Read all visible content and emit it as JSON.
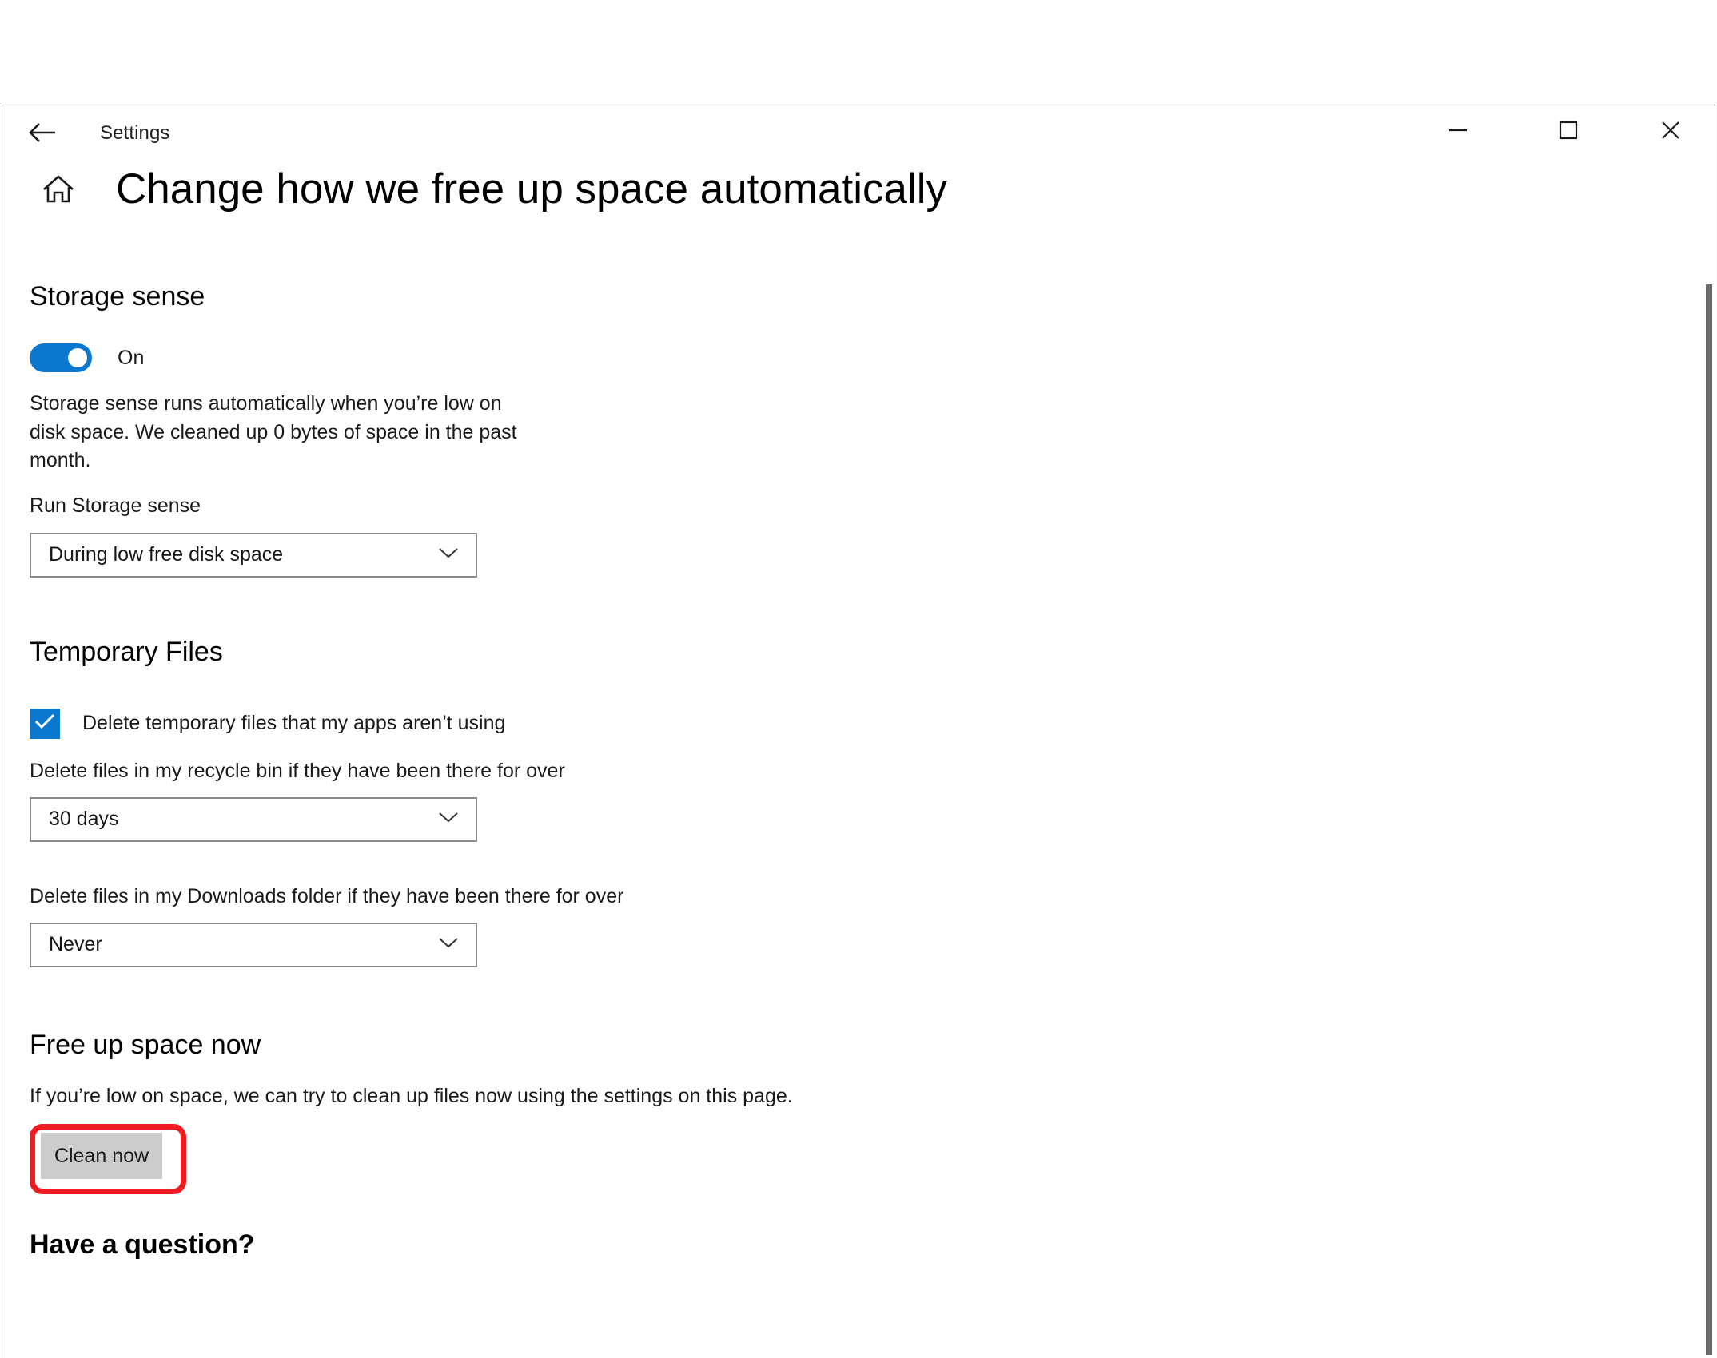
{
  "window": {
    "app_title": "Settings",
    "back_icon": "back-arrow-icon",
    "minimize_icon": "minimize-icon",
    "maximize_icon": "maximize-icon",
    "close_icon": "close-icon"
  },
  "header": {
    "home_icon": "home-icon",
    "page_title": "Change how we free up space automatically"
  },
  "storage_sense": {
    "heading": "Storage sense",
    "toggle_state": "On",
    "toggle_label": "On",
    "description": "Storage sense runs automatically when you’re low on disk space. We cleaned up 0 bytes of space in the past month.",
    "run_label": "Run Storage sense",
    "run_value": "During low free disk space",
    "chevron_icon": "chevron-down-icon"
  },
  "temporary_files": {
    "heading": "Temporary Files",
    "checkbox_checked": true,
    "checkbox_label": "Delete temporary files that my apps aren’t using",
    "recycle_bin_label": "Delete files in my recycle bin if they have been there for over",
    "recycle_bin_value": "30 days",
    "downloads_label": "Delete files in my Downloads folder if they have been there for over",
    "downloads_value": "Never"
  },
  "free_up_space": {
    "heading": "Free up space now",
    "description": "If you’re low on space, we can try to clean up files now using the settings on this page.",
    "clean_now_label": "Clean now"
  },
  "footer": {
    "have_a_question": "Have a question?"
  },
  "colors": {
    "accent": "#0b78d0",
    "highlight_annotation": "#ee1b20",
    "button_face": "#cccccc",
    "control_border": "#8a8a8a",
    "scrollbar_thumb": "#6b6b6b"
  }
}
